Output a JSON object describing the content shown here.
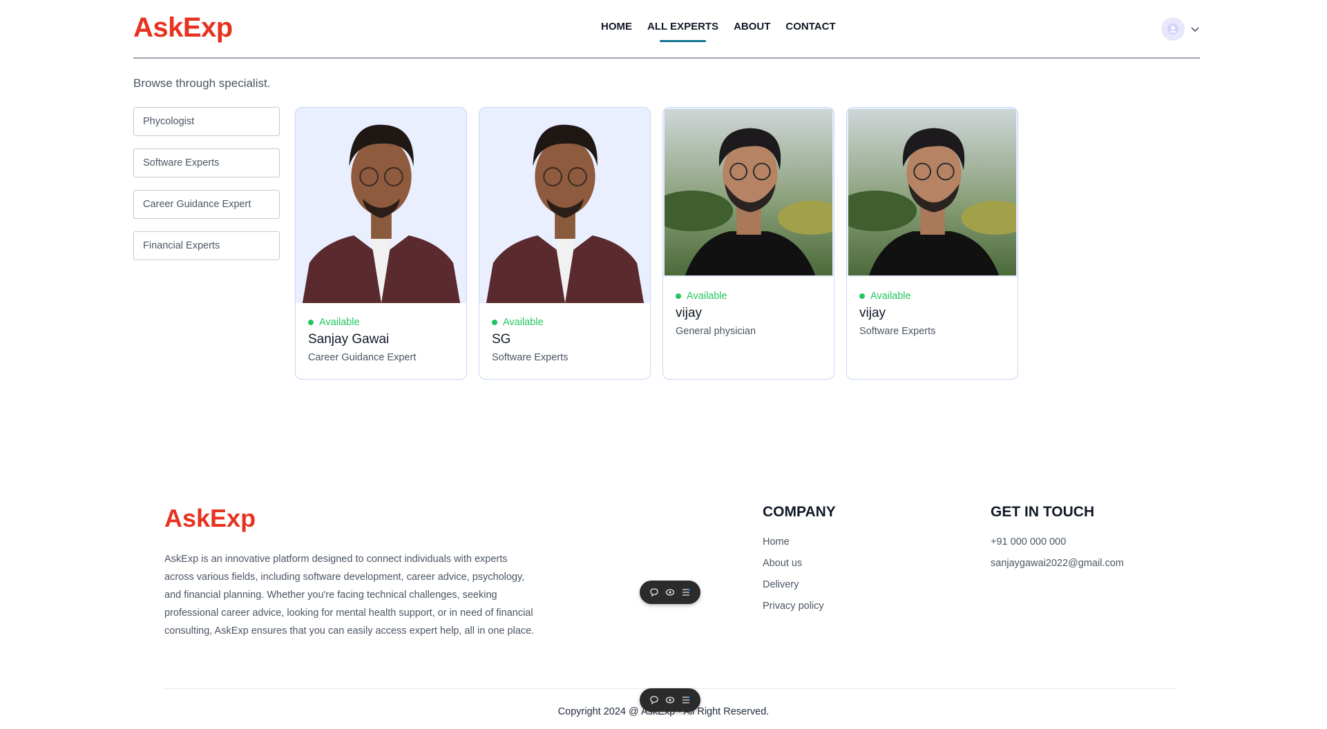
{
  "brand": {
    "name": "AskExp",
    "color": "#e7321f"
  },
  "nav": {
    "items": [
      {
        "label": "HOME",
        "active": false
      },
      {
        "label": "ALL EXPERTS",
        "active": true
      },
      {
        "label": "ABOUT",
        "active": false
      },
      {
        "label": "CONTACT",
        "active": false
      }
    ]
  },
  "main": {
    "intro": "Browse through specialist.",
    "filters": [
      "Phycologist",
      "Software Experts",
      "Career Guidance Expert",
      "Financial Experts"
    ],
    "experts": [
      {
        "status": "Available",
        "name": "Sanjay Gawai",
        "speciality": "Career Guidance Expert"
      },
      {
        "status": "Available",
        "name": "SG",
        "speciality": "Software Experts"
      },
      {
        "status": "Available",
        "name": "vijay",
        "speciality": "General physician"
      },
      {
        "status": "Available",
        "name": "vijay",
        "speciality": "Software Experts"
      }
    ]
  },
  "footer": {
    "description": "AskExp is an innovative platform designed to connect individuals with experts across various fields, including software development, career advice, psychology, and financial planning. Whether you're facing technical challenges, seeking professional career advice, looking for mental health support, or in need of financial consulting, AskExp ensures that you can easily access expert help, all in one place.",
    "company": {
      "title": "COMPANY",
      "links": [
        "Home",
        "About us",
        "Delivery",
        "Privacy policy"
      ]
    },
    "contact": {
      "title": "GET IN TOUCH",
      "phone": "+91 000 000 000",
      "email": "sanjaygawai2022@gmail.com"
    },
    "copyright": "Copyright 2024 @ AskExp - All Right Reserved."
  }
}
